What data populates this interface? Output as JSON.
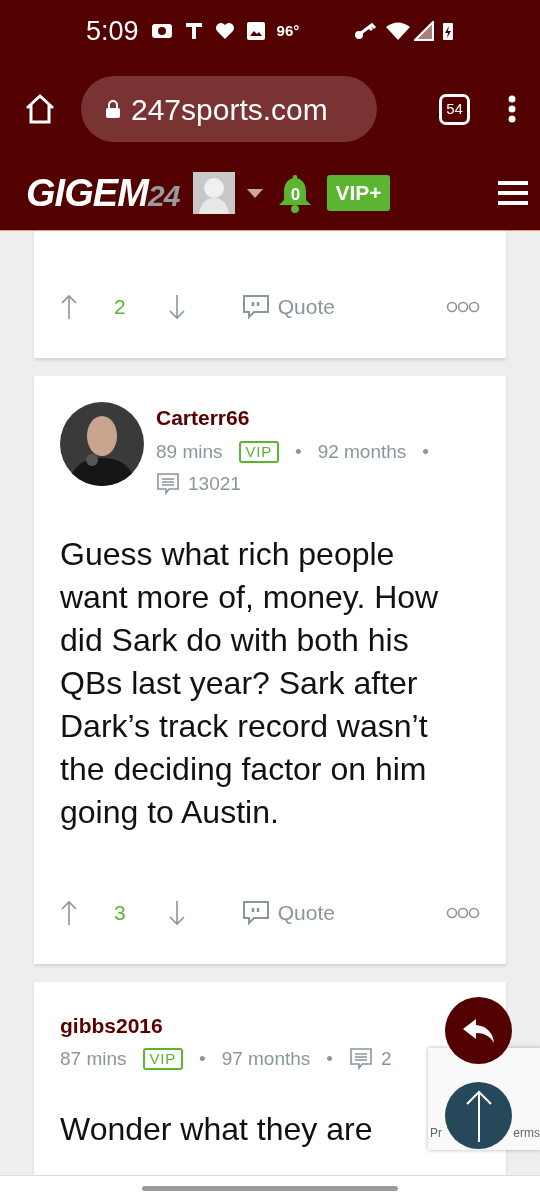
{
  "status_bar": {
    "time": "5:09",
    "temperature": "96°"
  },
  "browser": {
    "url": "247sports.com",
    "tab_count": "54"
  },
  "site_header": {
    "logo_main": "GIGEM",
    "logo_accent": "24",
    "notifications": "0",
    "vip_button": "VIP+"
  },
  "posts": [
    {
      "kind": "partial",
      "votes": "2",
      "quote": "Quote"
    },
    {
      "kind": "avatar_post",
      "author": "Carterr66",
      "time": "89 mins",
      "badge": "VIP",
      "separators": [
        "•",
        "•"
      ],
      "tenure": "92 months",
      "post_count": "13021",
      "body": "Guess what rich people want more of, money. How did Sark do with both his QBs last year? Sark after Dark’s track record wasn’t the deciding factor on him going to Austin.",
      "votes": "3",
      "quote": "Quote"
    },
    {
      "kind": "plain_post",
      "author": "gibbs2016",
      "time": "87 mins",
      "badge": "VIP",
      "separators": [
        "•",
        "•"
      ],
      "tenure": "97 months",
      "post_count": "2",
      "body": "Wonder what they are"
    }
  ],
  "recaptcha": {
    "left_text": "Pr",
    "right_text": "erms"
  }
}
